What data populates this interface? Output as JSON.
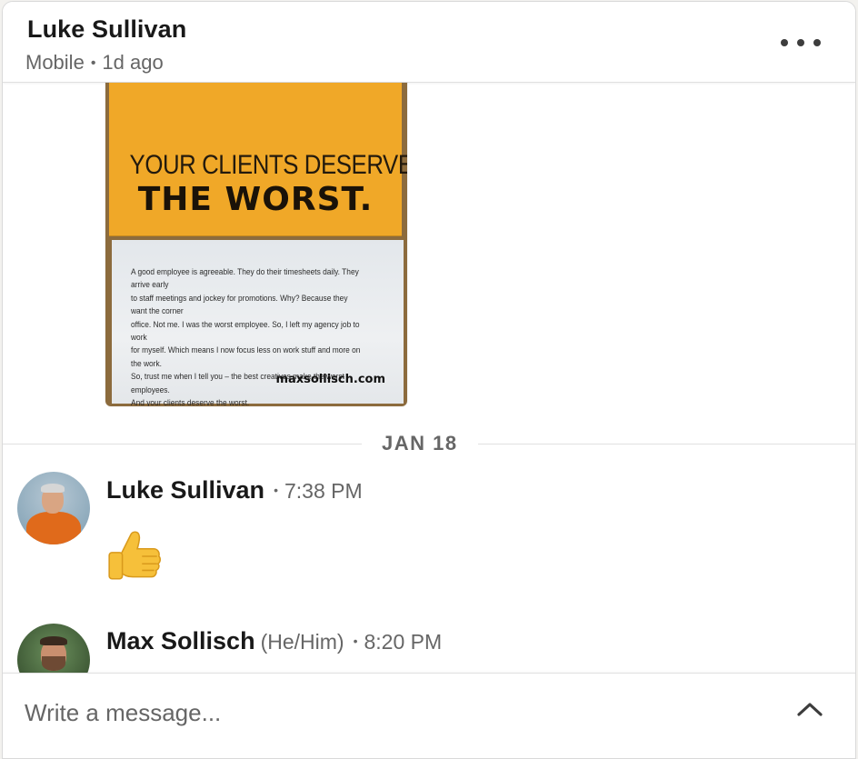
{
  "header": {
    "name": "Luke Sullivan",
    "status": "Mobile",
    "last_seen": "1d ago",
    "more_icon": "ellipsis-horizontal-icon"
  },
  "attachment": {
    "headline_line1": "YOUR CLIENTS DESERVE",
    "headline_line2": "THE WORST.",
    "body_text": "A good employee is agreeable. They do their timesheets daily. They arrive early\nto staff meetings and jockey for promotions. Why? Because they want the corner\noffice. Not me. I was the worst employee. So, I left my agency job to work\nfor myself. Which means I now focus less on work stuff and more on the work.\nSo, trust me when I tell you – the best creatives make the worst employees.\nAnd your clients deserve the worst.",
    "url": "maxsollisch.com",
    "colors": {
      "card_top": "#f0a828",
      "card_bottom": "#e9ecef"
    }
  },
  "date_divider": {
    "label": "JAN 18"
  },
  "messages": [
    {
      "sender": "Luke Sullivan",
      "pronouns": "",
      "time": "7:38 PM",
      "content_emoji": "thumbs-up-icon"
    },
    {
      "sender": "Max Sollisch",
      "pronouns": "(He/Him)",
      "time": "8:20 PM"
    }
  ],
  "composer": {
    "placeholder": "Write a message...",
    "expand_icon": "chevron-up-icon"
  },
  "colors": {
    "text_primary": "#191919",
    "text_secondary": "#666666",
    "divider": "#e0e0e0"
  }
}
